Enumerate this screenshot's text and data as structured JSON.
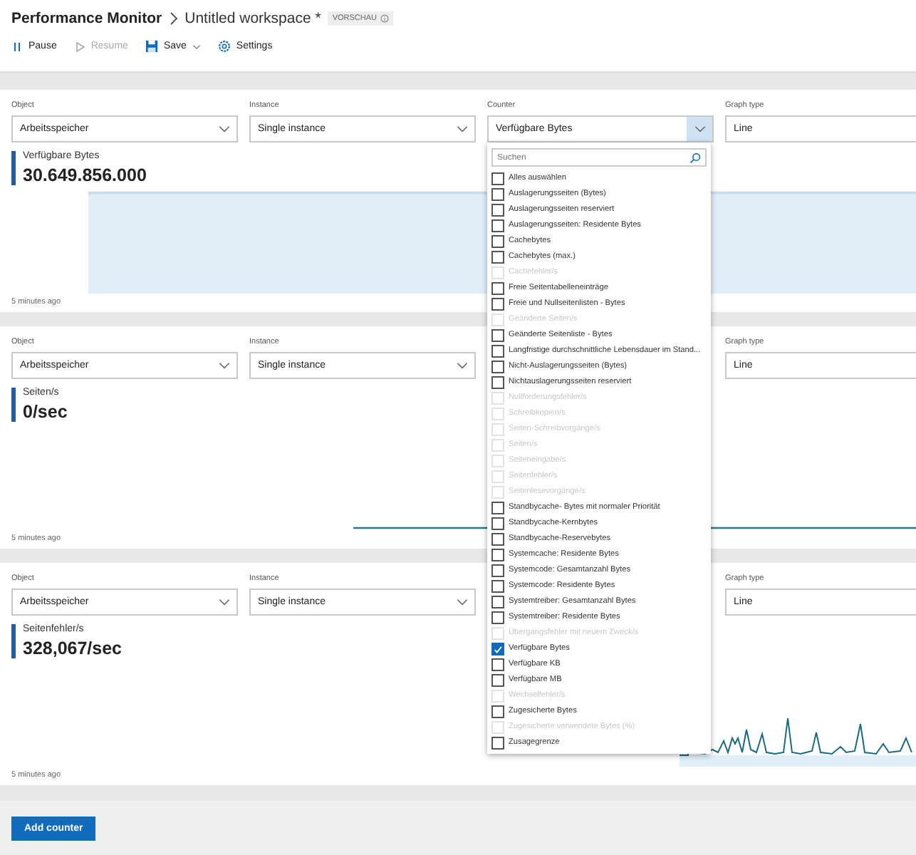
{
  "window": {
    "title": "Performance Monitor",
    "breadcrumb": "Untitled workspace *",
    "badge": "VORSCHAU"
  },
  "toolbar": [
    {
      "kind": "pause",
      "label": "Pause",
      "disabled": false
    },
    {
      "kind": "resume",
      "label": "Resume",
      "disabled": true
    },
    {
      "kind": "save",
      "label": "Save",
      "disabled": false
    },
    {
      "kind": "settings",
      "label": "Settings",
      "disabled": false
    }
  ],
  "panels": [
    {
      "object": {
        "label": "Object",
        "value": "Arbeitsspeicher"
      },
      "instance": {
        "label": "Instance",
        "value": "Single instance"
      },
      "counter": {
        "label": "Counter",
        "value": "Verfügbare Bytes",
        "open": true
      },
      "graph_type": {
        "label": "Graph type",
        "value": "Line"
      },
      "counter_name": "Verfügbare Bytes",
      "reading": "30.649.856.000",
      "updated": "5 minutes ago",
      "counter_menu": {
        "placeholder": "Suchen",
        "items": [
          {
            "label": "Alles auswählen",
            "checked": false,
            "disabled": false
          },
          {
            "label": "Auslagerungsseiten (Bytes)",
            "checked": false,
            "disabled": false
          },
          {
            "label": "Auslagerungsseiten reserviert",
            "checked": false,
            "disabled": false
          },
          {
            "label": "Auslagerungsseiten: Residente Bytes",
            "checked": false,
            "disabled": false
          },
          {
            "label": "Cachebytes",
            "checked": false,
            "disabled": false
          },
          {
            "label": "Cachebytes (max.)",
            "checked": false,
            "disabled": false
          },
          {
            "label": "Cachefehler/s",
            "checked": false,
            "disabled": true
          },
          {
            "label": "Freie Seitentabelleneinträge",
            "checked": false,
            "disabled": false
          },
          {
            "label": "Freie und Nullseitenlisten - Bytes",
            "checked": false,
            "disabled": false
          },
          {
            "label": "Geänderte Seiten/s",
            "checked": false,
            "disabled": true
          },
          {
            "label": "Geänderte Seitenliste - Bytes",
            "checked": false,
            "disabled": false
          },
          {
            "label": "Langfristige durchschnittliche Lebensdauer im Stand...",
            "checked": false,
            "disabled": false
          },
          {
            "label": "Nicht-Auslagerungsseiten (Bytes)",
            "checked": false,
            "disabled": false
          },
          {
            "label": "Nichtauslagerungsseiten reserviert",
            "checked": false,
            "disabled": false
          },
          {
            "label": "Nullforderungsfehler/s",
            "checked": false,
            "disabled": true
          },
          {
            "label": "Schreibkopien/s",
            "checked": false,
            "disabled": true
          },
          {
            "label": "Seiten-Schreibvorgänge/s",
            "checked": false,
            "disabled": true
          },
          {
            "label": "Seiten/s",
            "checked": false,
            "disabled": true
          },
          {
            "label": "Seiteneingabe/s",
            "checked": false,
            "disabled": true
          },
          {
            "label": "Seitenfehler/s",
            "checked": false,
            "disabled": true
          },
          {
            "label": "Seitenlesevorgänge/s",
            "checked": false,
            "disabled": true
          },
          {
            "label": "Standbycache- Bytes mit normaler Priorität",
            "checked": false,
            "disabled": false
          },
          {
            "label": "Standbycache-Kernbytes",
            "checked": false,
            "disabled": false
          },
          {
            "label": "Standbycache-Reservebytes",
            "checked": false,
            "disabled": false
          },
          {
            "label": "Systemcache: Residente Bytes",
            "checked": false,
            "disabled": false
          },
          {
            "label": "Systemcode: Gesamtanzahl Bytes",
            "checked": false,
            "disabled": false
          },
          {
            "label": "Systemcode: Residente Bytes",
            "checked": false,
            "disabled": false
          },
          {
            "label": "Systemtreiber: Gesamtanzahl Bytes",
            "checked": false,
            "disabled": false
          },
          {
            "label": "Systemtreiber: Residente Bytes",
            "checked": false,
            "disabled": false
          },
          {
            "label": "Übergangsfehler mit neuem Zweck/s",
            "checked": false,
            "disabled": true
          },
          {
            "label": "Verfügbare Bytes",
            "checked": true,
            "disabled": false
          },
          {
            "label": "Verfügbare KB",
            "checked": false,
            "disabled": false
          },
          {
            "label": "Verfügbare MB",
            "checked": false,
            "disabled": false
          },
          {
            "label": "Wechselfehler/s",
            "checked": false,
            "disabled": true
          },
          {
            "label": "Zugesicherte Bytes",
            "checked": false,
            "disabled": false
          },
          {
            "label": "Zugesicherte verwendete Bytes (%)",
            "checked": false,
            "disabled": true
          },
          {
            "label": "Zusagegrenze",
            "checked": false,
            "disabled": false
          }
        ]
      }
    },
    {
      "object": {
        "label": "Object",
        "value": "Arbeitsspeicher"
      },
      "instance": {
        "label": "Instance",
        "value": "Single instance"
      },
      "graph_type": {
        "label": "Graph type",
        "value": "Line"
      },
      "counter_name": "Seiten/s",
      "reading": "0/sec",
      "updated": "5 minutes ago"
    },
    {
      "object": {
        "label": "Object",
        "value": "Arbeitsspeicher"
      },
      "instance": {
        "label": "Instance",
        "value": "Single instance"
      },
      "graph_type": {
        "label": "Graph type",
        "value": "Line"
      },
      "counter_name": "Seitenfehler/s",
      "reading": "328,067/sec",
      "updated": "5 minutes ago"
    }
  ],
  "add_button": "Add counter"
}
